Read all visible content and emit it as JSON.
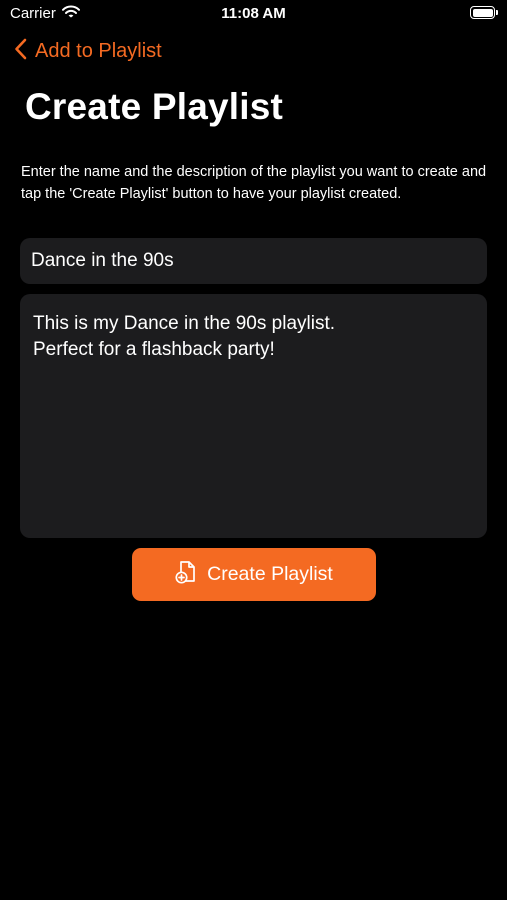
{
  "status_bar": {
    "carrier": "Carrier",
    "time": "11:08 AM",
    "battery_level": 1.0
  },
  "nav": {
    "back_label": "Add to Playlist"
  },
  "page": {
    "title": "Create Playlist",
    "instructions": "Enter the name and the description of the playlist you want to create and tap the 'Create Playlist' button to have your playlist created."
  },
  "form": {
    "name_value": "Dance in the 90s",
    "description_value": "This is my Dance in the 90s playlist.\nPerfect for a flashback party!"
  },
  "actions": {
    "create_label": "Create Playlist"
  },
  "colors": {
    "accent": "#f46a22",
    "background": "#000000",
    "field_background": "#1c1c1e",
    "text": "#ffffff"
  },
  "icons": {
    "back": "chevron-left-icon",
    "wifi": "wifi-icon",
    "battery": "battery-icon",
    "create": "document-plus-icon"
  }
}
